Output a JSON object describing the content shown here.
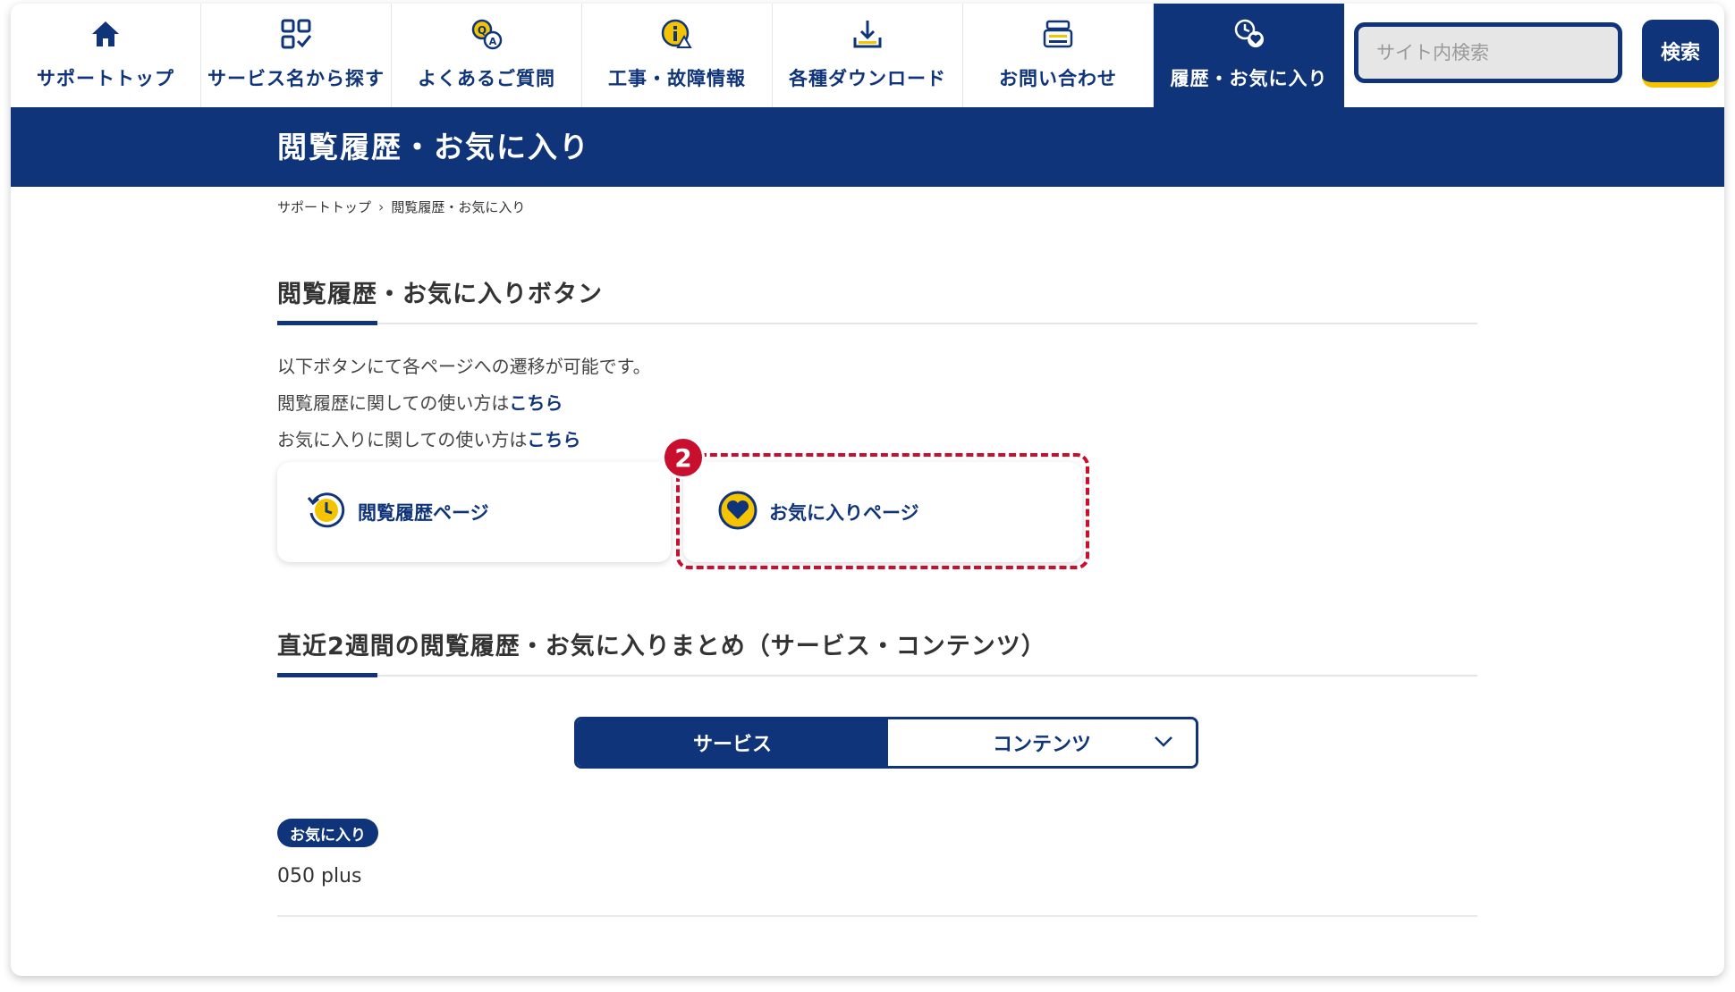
{
  "nav": {
    "items": [
      {
        "label": "サポートトップ",
        "icon": "home-icon"
      },
      {
        "label": "サービス名から探す",
        "icon": "grid-check-icon"
      },
      {
        "label": "よくあるご質問",
        "icon": "qa-icon"
      },
      {
        "label": "工事・故障情報",
        "icon": "warning-info-icon"
      },
      {
        "label": "各種ダウンロード",
        "icon": "download-icon"
      },
      {
        "label": "お問い合わせ",
        "icon": "contact-icon"
      },
      {
        "label": "履歴・お気に入り",
        "icon": "history-favorite-icon"
      }
    ],
    "search_placeholder": "サイト内検索",
    "search_button": "検索"
  },
  "page_title": "閲覧履歴・お気に入り",
  "breadcrumb": {
    "home": "サポートトップ",
    "current": "閲覧履歴・お気に入り"
  },
  "section1": {
    "title": "閲覧履歴・お気に入りボタン",
    "line1": "以下ボタンにて各ページへの遷移が可能です。",
    "line2_prefix": "閲覧履歴に関しての使い方は",
    "line3_prefix": "お気に入りに関しての使い方は",
    "link": "こちら",
    "history_button": "閲覧履歴ページ",
    "favorite_button": "お気に入りページ",
    "callout_number": "2"
  },
  "section2": {
    "title": "直近2週間の閲覧履歴・お気に入りまとめ（サービス・コンテンツ）",
    "tab_service": "サービス",
    "tab_contents": "コンテンツ",
    "item_badge": "お気に入り",
    "item_name": "050 plus"
  },
  "colors": {
    "brand": "#0f347a",
    "accent_yellow": "#f5c400",
    "callout_red": "#c8102e"
  }
}
